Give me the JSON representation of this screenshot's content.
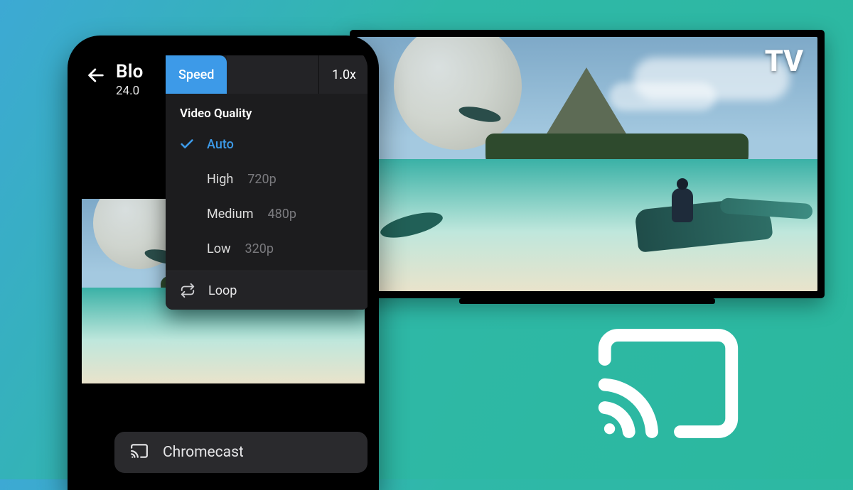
{
  "tv": {
    "badge": "TV"
  },
  "phone": {
    "title": "Blo",
    "subtitle": "24.0"
  },
  "panel": {
    "speed_label": "Speed",
    "speed_value": "1.0x",
    "quality_header": "Video Quality",
    "quality": {
      "auto": {
        "label": "Auto",
        "res": ""
      },
      "high": {
        "label": "High",
        "res": "720p"
      },
      "medium": {
        "label": "Medium",
        "res": "480p"
      },
      "low": {
        "label": "Low",
        "res": "320p"
      }
    },
    "loop_label": "Loop"
  },
  "cast": {
    "label": "Chromecast"
  }
}
